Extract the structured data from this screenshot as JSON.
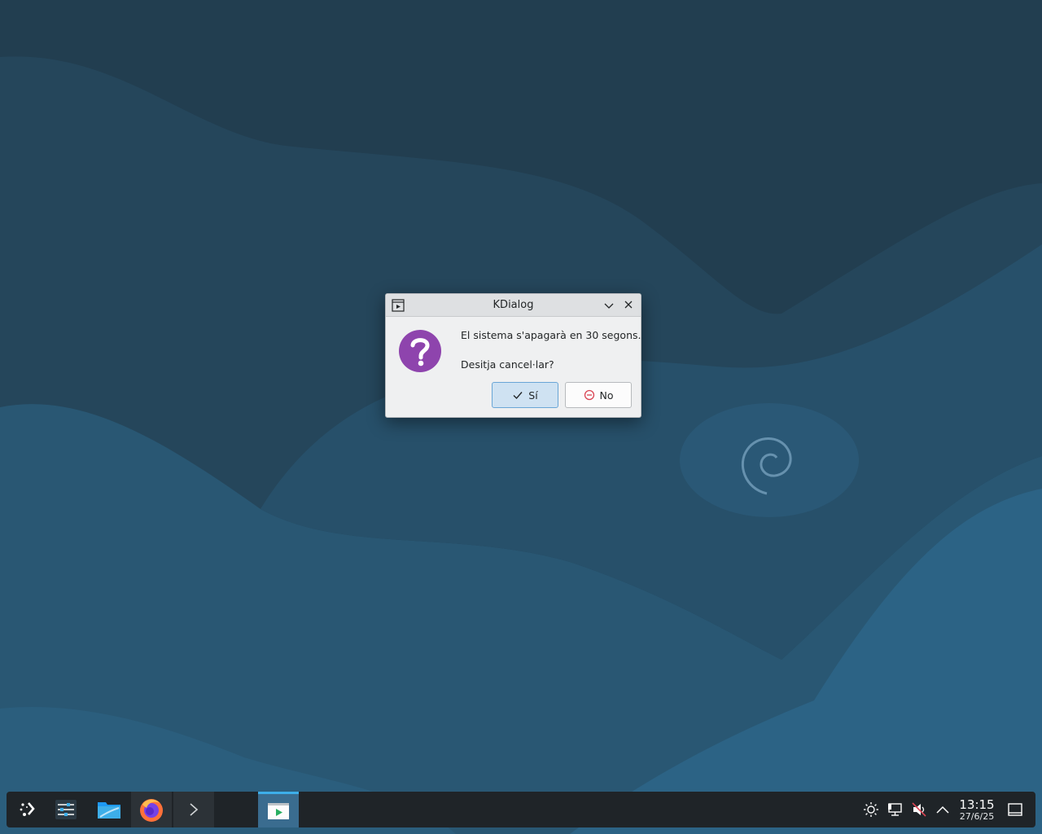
{
  "dialog": {
    "title": "KDialog",
    "message_line1": "El sistema s'apagarà en 30 segons.",
    "message_line2": "Desitja cancel·lar?",
    "yes_label": "Sí",
    "no_label": "No",
    "icons": {
      "app": "window-icon",
      "message": "question-icon",
      "minimize": "chevron-down-icon",
      "close": "close-icon",
      "yes": "checkmark-icon",
      "no": "no-entry-icon"
    }
  },
  "taskbar": {
    "items": [
      {
        "name": "launcher",
        "icon": "app-launcher-icon"
      },
      {
        "name": "system-settings",
        "icon": "sliders-icon"
      },
      {
        "name": "file-manager",
        "icon": "folder-icon"
      },
      {
        "name": "firefox",
        "icon": "firefox-icon"
      },
      {
        "name": "terminal",
        "icon": "terminal-icon"
      },
      {
        "name": "kdialog",
        "icon": "kdialog-window-icon",
        "active": true
      }
    ],
    "tray": {
      "icons": [
        "brightness-icon",
        "network-icon",
        "volume-muted-icon",
        "chevron-up-icon"
      ],
      "clock_time": "13:15",
      "clock_date": "27/6/25"
    }
  },
  "colors": {
    "accent": "#3daee9",
    "question_purple": "#8e44ad",
    "no_red": "#da4453",
    "taskbar_bg": "#1f2428",
    "dialog_bg": "#eff0f1"
  }
}
